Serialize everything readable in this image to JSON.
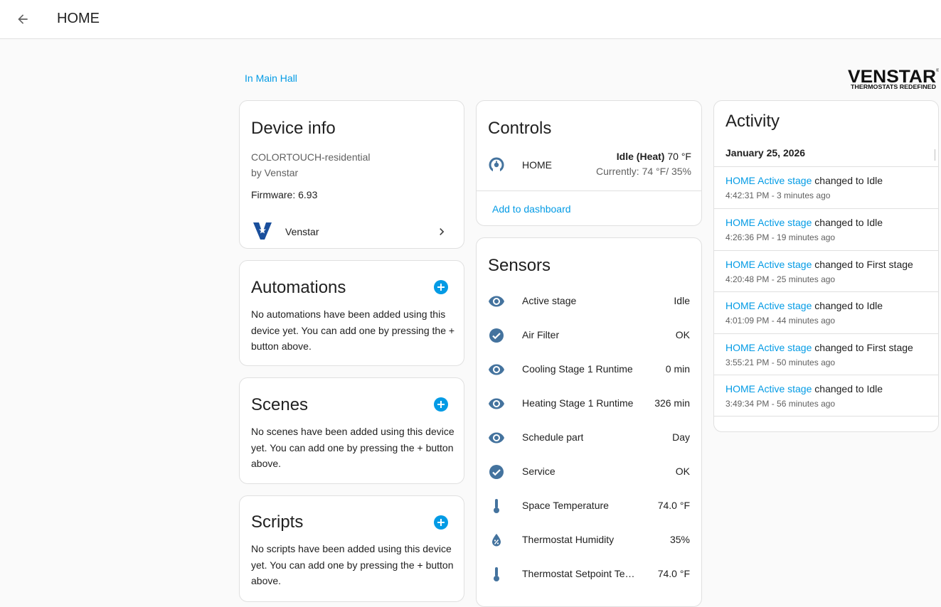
{
  "header": {
    "title": "HOME"
  },
  "area_link": "In Main Hall",
  "brand": {
    "name": "VENSTAR",
    "tagline": "THERMOSTATS REDEFINED"
  },
  "device_info": {
    "title": "Device info",
    "model": "COLORTOUCH-residential",
    "manufacturer": "by Venstar",
    "firmware": "Firmware: 6.93",
    "integration": "Venstar"
  },
  "automations": {
    "title": "Automations",
    "text": "No automations have been added using this device yet. You can add one by pressing the + button above."
  },
  "scenes": {
    "title": "Scenes",
    "text": "No scenes have been added using this device yet. You can add one by pressing the + button above."
  },
  "scripts": {
    "title": "Scripts",
    "text": "No scripts have been added using this device yet. You can add one by pressing the + button above."
  },
  "controls": {
    "title": "Controls",
    "entity_name": "HOME",
    "state_bold": "Idle (Heat)",
    "state_temp": " 70 °F",
    "current": "Currently: 74 °F/ 35%",
    "add_to_dashboard": "Add to dashboard"
  },
  "sensors": {
    "title": "Sensors",
    "rows": [
      {
        "icon": "eye-icon",
        "name": "Active stage",
        "value": "Idle"
      },
      {
        "icon": "check-circle-icon",
        "name": "Air Filter",
        "value": "OK"
      },
      {
        "icon": "eye-icon",
        "name": "Cooling Stage 1 Runtime",
        "value": "0 min"
      },
      {
        "icon": "eye-icon",
        "name": "Heating Stage 1 Runtime",
        "value": "326 min"
      },
      {
        "icon": "eye-icon",
        "name": "Schedule part",
        "value": "Day"
      },
      {
        "icon": "check-circle-icon",
        "name": "Service",
        "value": "OK"
      },
      {
        "icon": "thermometer-icon",
        "name": "Space Temperature",
        "value": "74.0 °F"
      },
      {
        "icon": "water-percent-icon",
        "name": "Thermostat Humidity",
        "value": "35%"
      },
      {
        "icon": "thermometer-icon",
        "name": "Thermostat Setpoint Temp…",
        "value": "74.0 °F"
      }
    ]
  },
  "activity": {
    "title": "Activity",
    "date": "January 25, 2026",
    "entries": [
      {
        "entity": "HOME Active stage",
        "change": " changed to Idle",
        "time": "4:42:31 PM - 3 minutes ago"
      },
      {
        "entity": "HOME Active stage",
        "change": " changed to Idle",
        "time": "4:26:36 PM - 19 minutes ago"
      },
      {
        "entity": "HOME Active stage",
        "change": " changed to First stage",
        "time": "4:20:48 PM - 25 minutes ago"
      },
      {
        "entity": "HOME Active stage",
        "change": " changed to Idle",
        "time": "4:01:09 PM - 44 minutes ago"
      },
      {
        "entity": "HOME Active stage",
        "change": " changed to First stage",
        "time": "3:55:21 PM - 50 minutes ago"
      },
      {
        "entity": "HOME Active stage",
        "change": " changed to Idle",
        "time": "3:49:34 PM - 56 minutes ago"
      }
    ]
  },
  "colors": {
    "accent": "#039be5",
    "icon": "#44739e",
    "divider": "#e0e0e0"
  }
}
